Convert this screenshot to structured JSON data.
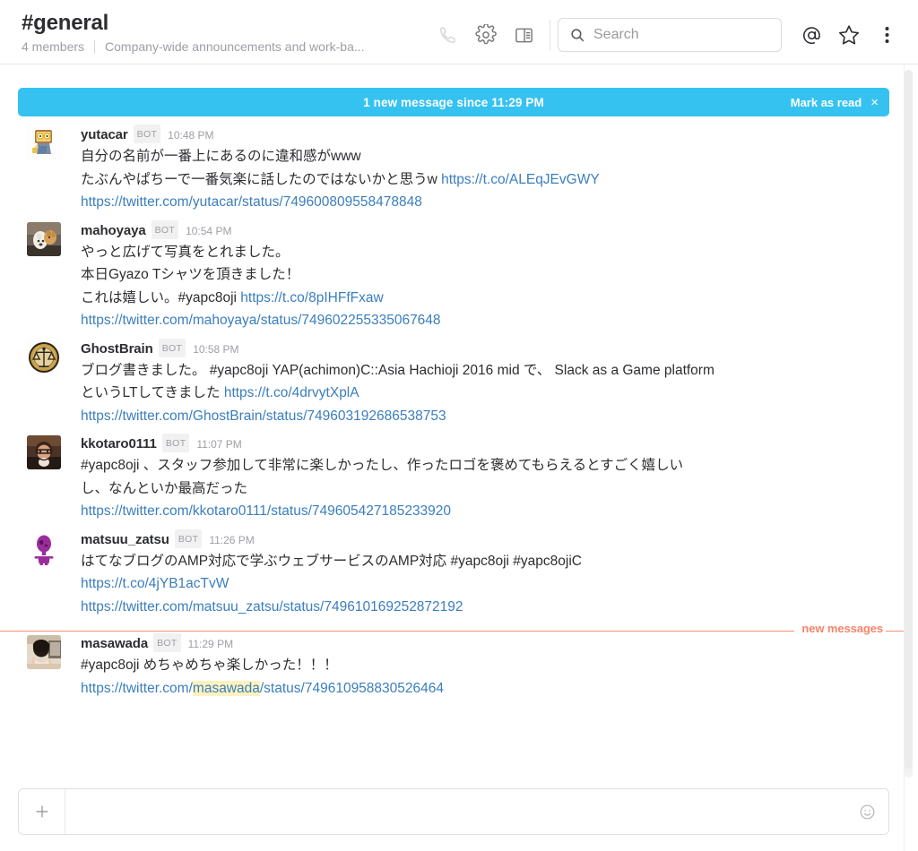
{
  "header": {
    "channel_name": "#general",
    "member_count": "4 members",
    "topic": "Company-wide announcements and work-ba...",
    "icons": {
      "call": "phone-icon",
      "settings": "gear-icon",
      "panel": "sidebar-panel-icon",
      "mentions": "at-mentions-icon",
      "star": "star-icon",
      "more": "kebab-menu-icon"
    },
    "search": {
      "placeholder": "Search",
      "value": "",
      "icon": "search-icon"
    }
  },
  "banner": {
    "text": "1 new message since 11:29 PM",
    "mark_as_read": "Mark as read",
    "close": "×",
    "color": "#35c2f1"
  },
  "divider": {
    "label": "new messages",
    "color": "#f8836b"
  },
  "messages": [
    {
      "author": "yutacar",
      "badge": "BOT",
      "time": "10:48 PM",
      "avatar": "cartoon-glasses-avatar",
      "lines": [
        [
          {
            "t": "text",
            "v": "自分の名前が一番上にあるのに違和感がwww"
          }
        ],
        [
          {
            "t": "text",
            "v": "たぶんやぱちーで一番気楽に話したのではないかと思うw "
          },
          {
            "t": "link",
            "v": "https://t.co/ALEqJEvGWY"
          }
        ],
        [
          {
            "t": "link",
            "v": "https://twitter.com/yutacar/status/749600809558478848"
          }
        ]
      ]
    },
    {
      "author": "mahoyaya",
      "badge": "BOT",
      "time": "10:54 PM",
      "avatar": "dog-photo-avatar",
      "lines": [
        [
          {
            "t": "text",
            "v": "やっと広げて写真をとれました。"
          }
        ],
        [
          {
            "t": "text",
            "v": "本日Gyazo Tシャツを頂きました！"
          }
        ],
        [
          {
            "t": "text",
            "v": "これは嬉しい。#yapc8oji "
          },
          {
            "t": "link",
            "v": "https://t.co/8pIHFfFxaw"
          }
        ],
        [
          {
            "t": "link",
            "v": "https://twitter.com/mahoyaya/status/749602255335067648"
          }
        ]
      ]
    },
    {
      "author": "GhostBrain",
      "badge": "BOT",
      "time": "10:58 PM",
      "avatar": "scales-emblem-avatar",
      "lines": [
        [
          {
            "t": "text",
            "v": "ブログ書きました。 #yapc8oji YAP(achimon)C::Asia Hachioji 2016 mid で、 Slack as a Game platform"
          }
        ],
        [
          {
            "t": "text",
            "v": "というLTしてきました "
          },
          {
            "t": "link",
            "v": "https://t.co/4drvytXplA"
          }
        ],
        [
          {
            "t": "link",
            "v": "https://twitter.com/GhostBrain/status/749603192686538753"
          }
        ]
      ]
    },
    {
      "author": "kkotaro0111",
      "badge": "BOT",
      "time": "11:07 PM",
      "avatar": "person-glasses-photo-avatar",
      "lines": [
        [
          {
            "t": "text",
            "v": "#yapc8oji 、スタッフ参加して非常に楽しかったし、作ったロゴを褒めてもらえるとすごく嬉しい"
          }
        ],
        [
          {
            "t": "text",
            "v": "し、なんといか最高だった"
          }
        ],
        [
          {
            "t": "link",
            "v": "https://twitter.com/kkotaro0111/status/749605427185233920"
          }
        ]
      ]
    },
    {
      "author": "matsuu_zatsu",
      "badge": "BOT",
      "time": "11:26 PM",
      "avatar": "purple-alien-avatar",
      "lines": [
        [
          {
            "t": "text",
            "v": "はてなブログのAMP対応で学ぶウェブサービスのAMP対応 #yapc8oji #yapc8ojiC"
          }
        ],
        [
          {
            "t": "link",
            "v": "https://t.co/4jYB1acTvW"
          }
        ],
        [
          {
            "t": "link",
            "v": "https://twitter.com/matsuu_zatsu/status/749610169252872192"
          }
        ]
      ]
    },
    {
      "author": "masawada",
      "badge": "BOT",
      "time": "11:29 PM",
      "avatar": "person-laptop-photo-avatar",
      "new_above": true,
      "lines": [
        [
          {
            "t": "text",
            "v": "#yapc8oji めちゃめちゃ楽しかった！！！"
          }
        ],
        [
          {
            "t": "link",
            "v": "https://twitter.com/"
          },
          {
            "t": "link-hl",
            "v": "masawada"
          },
          {
            "t": "link",
            "v": "/status/749610958830526464"
          }
        ]
      ]
    }
  ],
  "composer": {
    "placeholder": "",
    "value": "",
    "add_icon": "plus-icon",
    "emoji_icon": "smiley-icon"
  }
}
